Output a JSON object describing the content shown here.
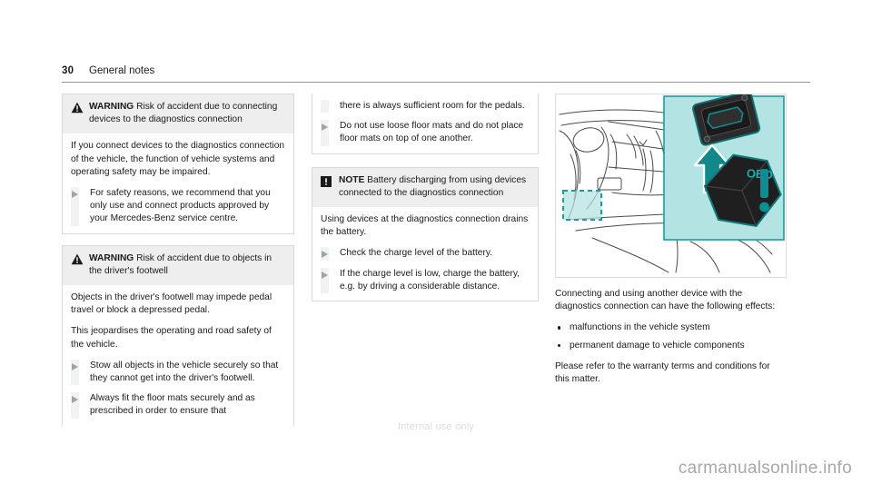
{
  "header": {
    "page_number": "30",
    "title": "General notes"
  },
  "colors": {
    "accent_teal": "#1b9c9c",
    "inset_fill": "#b3e3e2",
    "hazard_head_bg": "#eeeeee",
    "rule": "#8a9a9a",
    "bullet_triangle": "#9aa5a5"
  },
  "left_column": {
    "warning_1": {
      "icon": "warning-triangle-icon",
      "keyword": "WARNING",
      "headline": " Risk of accident due to connecting devices to the diagnostics connection",
      "body_paragraphs": [
        "If you connect devices to the diagnostics connection of the vehicle, the function of vehicle systems and operating safety may be impaired."
      ],
      "actions": [
        "For safety reasons, we recommend that you only use and connect products approved by your Mercedes-Benz service centre."
      ]
    },
    "warning_2": {
      "icon": "warning-triangle-icon",
      "keyword": "WARNING",
      "headline": " Risk of accident due to objects in the driver's footwell",
      "body_paragraphs": [
        "Objects in the driver's footwell may impede pedal travel or block a depressed pedal.",
        "This jeopardises the operating and road safety of the vehicle."
      ],
      "actions": [
        "Stow all objects in the vehicle securely so that they cannot get into the driver's footwell.",
        "Always fit the floor mats securely and as prescribed in order to ensure that"
      ]
    }
  },
  "middle_column": {
    "continued_box": {
      "continued_text": "there is always sufficient room for the pedals.",
      "actions": [
        "Do not use loose floor mats and do not place floor mats on top of one another."
      ]
    },
    "note_box": {
      "icon": "note-exclamation-icon",
      "keyword": "NOTE",
      "headline": " Battery discharging from using devices connected to the diagnostics connection",
      "body_paragraphs": [
        "Using devices at the diagnostics connection drains the battery."
      ],
      "actions": [
        "Check the charge level of the battery.",
        "If the charge level is low, charge the battery, e.g. by driving a considerable distance."
      ]
    }
  },
  "right_column": {
    "figure": {
      "name": "diagnostics-connection-illustration",
      "caption_label": "OBD",
      "alert_glyph": "!"
    },
    "intro": "Connecting and using another device with the diagnostics connection can have the following effects:",
    "effects": [
      "malfunctions in the vehicle system",
      "permanent damage to vehicle components"
    ],
    "closing": "Please refer to the warranty terms and conditions for this matter."
  },
  "watermarks": {
    "internal": "Internal use only",
    "site": "carmanualsonline.info"
  }
}
